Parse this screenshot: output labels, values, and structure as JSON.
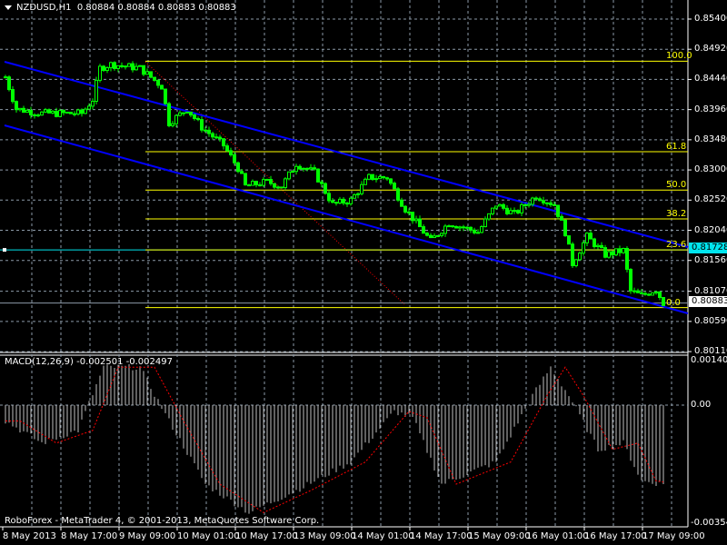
{
  "header": {
    "symbol": "NZDUSD,H1",
    "ohlc": "0.80884 0.80884 0.80883 0.80883"
  },
  "price_axis": [
    "0.85400",
    "0.84920",
    "0.84440",
    "0.83960",
    "0.83480",
    "0.83000",
    "0.82520",
    "0.82040",
    "0.81560",
    "0.81070",
    "0.80590",
    "0.80110"
  ],
  "current_price": "0.80883",
  "hline_price": "0.81728",
  "fib_levels": [
    {
      "label": "100.0",
      "price": 0.8473
    },
    {
      "label": "61.8",
      "price": 0.8329
    },
    {
      "label": "50.0",
      "price": 0.8268
    },
    {
      "label": "38.2",
      "price": 0.8222
    },
    {
      "label": "23.6",
      "price": 0.81728
    },
    {
      "label": "0.0",
      "price": 0.8081
    }
  ],
  "macd": {
    "label": "MACD(12,26,9) -0.002501 -0.002497",
    "axis_top": "0.001409",
    "axis_zero": "0.00",
    "axis_bottom": "-0.003543"
  },
  "time_axis": [
    "8 May 2013",
    "8 May 17:00",
    "9 May 09:00",
    "10 May 01:00",
    "10 May 17:00",
    "13 May 09:00",
    "14 May 01:00",
    "14 May 17:00",
    "15 May 09:00",
    "16 May 01:00",
    "16 May 17:00",
    "17 May 09:00"
  ],
  "footer": "RoboForex - MetaTrader 4, © 2001-2013, MetaQuotes Software Corp.",
  "colors": {
    "bull": "#00ff00",
    "channel": "#0000ff",
    "fib": "#ffff00",
    "hline": "#00e5ee",
    "grid": "#8c9aa8",
    "macd_signal": "#ff0000",
    "macd_hist": "#c0c0c0"
  },
  "chart_data": {
    "type": "candlestick",
    "bars": 182,
    "price_keypoints": [
      [
        0,
        0.8448
      ],
      [
        3,
        0.8397
      ],
      [
        10,
        0.839
      ],
      [
        21,
        0.839
      ],
      [
        24,
        0.8412
      ],
      [
        26,
        0.8462
      ],
      [
        29,
        0.8468
      ],
      [
        37,
        0.8462
      ],
      [
        43,
        0.8433
      ],
      [
        45,
        0.8375
      ],
      [
        50,
        0.8397
      ],
      [
        54,
        0.8368
      ],
      [
        60,
        0.8339
      ],
      [
        64,
        0.8303
      ],
      [
        66,
        0.8274
      ],
      [
        72,
        0.8281
      ],
      [
        76,
        0.8274
      ],
      [
        80,
        0.831
      ],
      [
        85,
        0.8296
      ],
      [
        90,
        0.8245
      ],
      [
        95,
        0.8252
      ],
      [
        100,
        0.8288
      ],
      [
        105,
        0.8288
      ],
      [
        110,
        0.8238
      ],
      [
        117,
        0.8187
      ],
      [
        122,
        0.8216
      ],
      [
        130,
        0.8201
      ],
      [
        135,
        0.8245
      ],
      [
        140,
        0.823
      ],
      [
        146,
        0.8259
      ],
      [
        151,
        0.8245
      ],
      [
        154,
        0.8201
      ],
      [
        156,
        0.8151
      ],
      [
        160,
        0.8194
      ],
      [
        165,
        0.8165
      ],
      [
        170,
        0.8172
      ],
      [
        172,
        0.8107
      ],
      [
        175,
        0.81
      ],
      [
        179,
        0.811
      ],
      [
        181,
        0.8088
      ]
    ],
    "macd_keypoints": [
      [
        0,
        -0.0005
      ],
      [
        10,
        -0.0012
      ],
      [
        20,
        -0.0008
      ],
      [
        27,
        0.0012
      ],
      [
        37,
        0.0012
      ],
      [
        45,
        -0.0005
      ],
      [
        55,
        -0.0025
      ],
      [
        67,
        -0.0034
      ],
      [
        80,
        -0.0027
      ],
      [
        95,
        -0.0018
      ],
      [
        107,
        -0.0002
      ],
      [
        112,
        -0.0004
      ],
      [
        120,
        -0.0025
      ],
      [
        135,
        -0.0018
      ],
      [
        145,
        0.0003
      ],
      [
        150,
        0.0012
      ],
      [
        155,
        0.0003
      ],
      [
        163,
        -0.0014
      ],
      [
        170,
        -0.0012
      ],
      [
        175,
        -0.0024
      ],
      [
        181,
        -0.0025
      ]
    ]
  }
}
